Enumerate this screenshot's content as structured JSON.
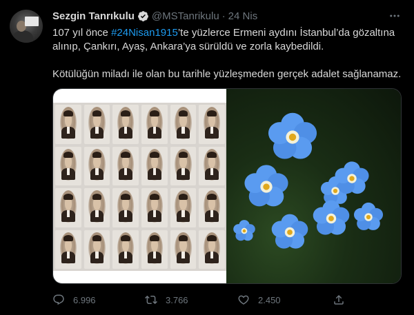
{
  "tweet": {
    "author_name": "Sezgin Tanrıkulu",
    "handle": "@MSTanrikulu",
    "separator": "·",
    "date": "24 Nis",
    "text_before_hashtag": "107 yıl önce ",
    "hashtag": "#24Nisan1915",
    "text_after_hashtag": "’te yüzlerce Ermeni aydını İstanbul’da gözaltına alınıp, Çankırı, Ayaş, Ankara’ya sürüldü ve zorla kaybedildi.",
    "text_paragraph2": "Kötülüğün miladı ile olan bu tarihle yüzleşmeden gerçek adalet sağlanamaz."
  },
  "actions": {
    "reply_count": "6.996",
    "retweet_count": "3.766",
    "like_count": "2.450"
  },
  "icons": {
    "verified": "verified-badge-icon",
    "more": "more-options-icon",
    "reply": "reply-icon",
    "retweet": "retweet-icon",
    "like": "heart-icon",
    "share": "share-icon"
  },
  "colors": {
    "background": "#000000",
    "text": "#d9d9d9",
    "secondary": "#6e767d",
    "accent": "#1d9bf0",
    "verified": "#d9d9d9"
  }
}
